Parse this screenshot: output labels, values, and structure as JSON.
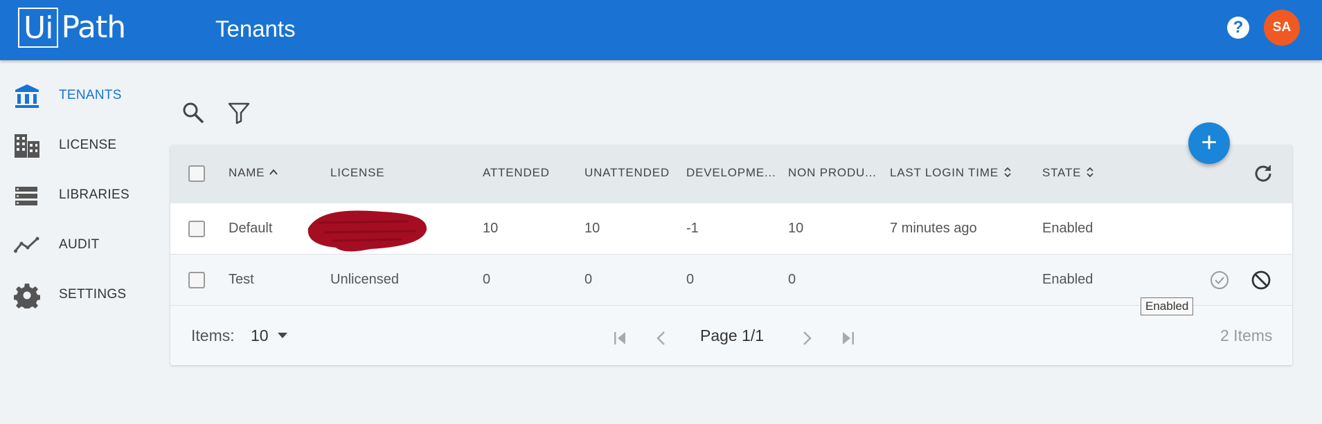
{
  "header": {
    "logo_box": "Ui",
    "logo_rest": "Path",
    "title": "Tenants",
    "help_icon": "question-circle-icon",
    "avatar_initials": "SA",
    "avatar_color": "#f05a22",
    "brand_color": "#1a73d2"
  },
  "sidebar": {
    "items": [
      {
        "label": "TENANTS",
        "icon": "bank-icon",
        "active": true
      },
      {
        "label": "LICENSE",
        "icon": "building-icon",
        "active": false
      },
      {
        "label": "LIBRARIES",
        "icon": "list-icon",
        "active": false
      },
      {
        "label": "AUDIT",
        "icon": "trend-line-icon",
        "active": false
      },
      {
        "label": "SETTINGS",
        "icon": "gear-icon",
        "active": false
      }
    ]
  },
  "toolbar": {
    "search_icon": "search-icon",
    "filter_icon": "filter-icon",
    "add_icon": "plus-icon"
  },
  "table": {
    "columns": {
      "name": "NAME",
      "license": "LICENSE",
      "attended": "ATTENDED",
      "unattended": "UNATTENDED",
      "development": "DEVELOPME...",
      "non_production": "NON PRODU...",
      "last_login": "LAST LOGIN TIME",
      "state": "STATE"
    },
    "rows": [
      {
        "name": "Default",
        "license": "",
        "attended": "10",
        "unattended": "10",
        "development": "-1",
        "non_production": "10",
        "last_login": "7 minutes ago",
        "state": "Enabled"
      },
      {
        "name": "Test",
        "license": "Unlicensed",
        "attended": "0",
        "unattended": "0",
        "development": "0",
        "non_production": "0",
        "last_login": "",
        "state": "Enabled"
      }
    ],
    "tooltip": "Enabled"
  },
  "footer": {
    "items_label": "Items:",
    "page_size": "10",
    "page_label": "Page 1/1",
    "total": "2 Items"
  }
}
